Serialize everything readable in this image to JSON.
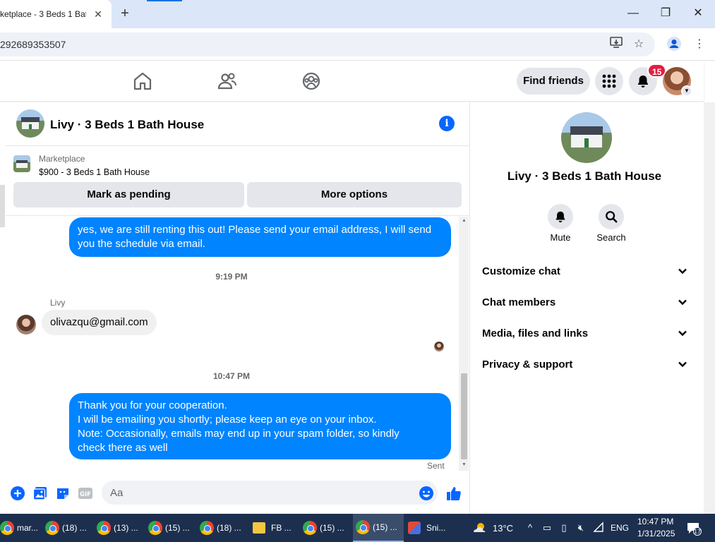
{
  "browser": {
    "tab_title": "ketplace - 3 Beds 1 Bat",
    "url": "292689353507"
  },
  "fb_header": {
    "find_friends_label": "Find friends",
    "notification_count": "15"
  },
  "chat": {
    "title": "Livy · 3 Beds 1 Bath House",
    "marketplace_label": "Marketplace",
    "listing": "$900 - 3 Beds 1 Bath House",
    "mark_pending_label": "Mark as pending",
    "more_options_label": "More options",
    "messages": [
      {
        "type": "out",
        "text_lines": [
          "yes, we are still renting this out! Please send your email address, I will send",
          "you the schedule via email."
        ]
      },
      {
        "type": "time",
        "text": "9:19 PM"
      },
      {
        "type": "in",
        "sender": "Livy",
        "text": "olivazqu@gmail.com"
      },
      {
        "type": "time",
        "text": "10:47 PM"
      },
      {
        "type": "out",
        "text_lines": [
          "Thank you for your cooperation.",
          "I will be emailing you shortly; please keep an eye on your inbox.",
          "Note: Occasionally, emails may end up in your spam folder, so kindly",
          "check there as well"
        ]
      }
    ],
    "sent_status": "Sent",
    "composer_placeholder": "Aa",
    "gif_label": "GIF"
  },
  "details": {
    "name": "Livy · 3 Beds 1 Bath House",
    "mute_label": "Mute",
    "search_label": "Search",
    "sections": [
      "Customize chat",
      "Chat members",
      "Media, files and links",
      "Privacy & support"
    ]
  },
  "taskbar": {
    "items": [
      "mar...",
      "(18) ...",
      "(13) ...",
      "(15) ...",
      "(18) ...",
      "FB ...",
      "(15) ...",
      "(15) ...",
      "Sni..."
    ],
    "temperature": "13°C",
    "language": "ENG",
    "time": "10:47 PM",
    "date": "1/31/2025",
    "notifications": "17"
  },
  "colors": {
    "messenger_blue": "#0084ff",
    "fb_blue": "#0866ff",
    "badge_red": "#e41e3f",
    "taskbar": "#1c2f4e"
  }
}
